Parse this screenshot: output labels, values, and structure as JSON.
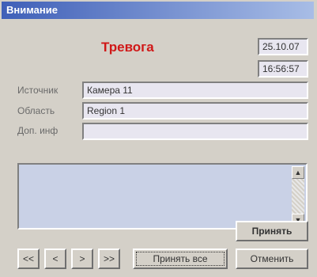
{
  "window": {
    "title": "Внимание"
  },
  "alarm": {
    "title": "Тревога",
    "date": "25.10.07",
    "time": "16:56:57"
  },
  "fields": {
    "source_label": "Источник",
    "source_value": "Камера 11",
    "area_label": "Область",
    "area_value": "Region 1",
    "info_label": "Доп. инф",
    "info_value": ""
  },
  "buttons": {
    "accept": "Принять",
    "first": "<<",
    "prev": "<",
    "next": ">",
    "last": ">>",
    "accept_all": "Принять все",
    "cancel": "Отменить"
  },
  "icons": {
    "scroll_up": "scroll-up-arrow",
    "scroll_down": "scroll-down-arrow"
  }
}
